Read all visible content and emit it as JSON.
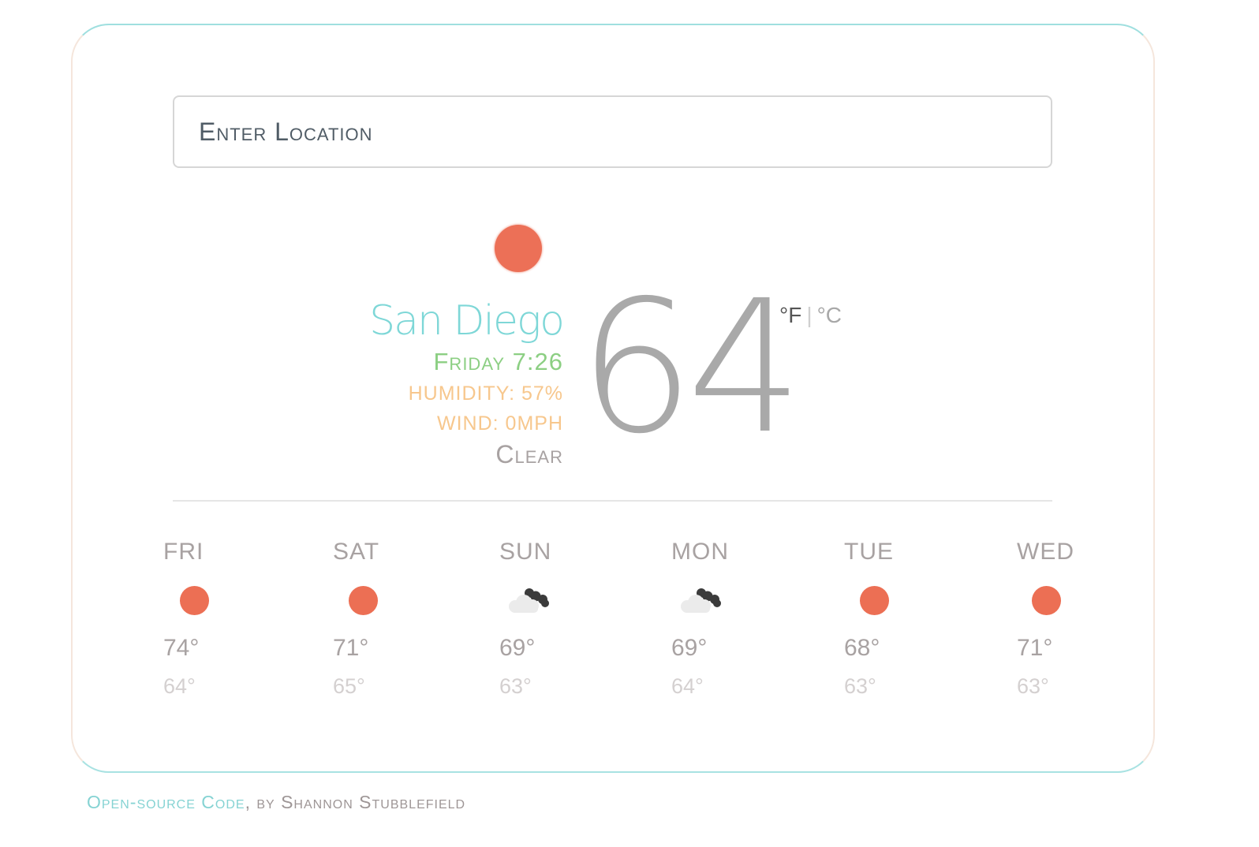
{
  "search": {
    "placeholder": "Enter Location"
  },
  "current": {
    "icon": "sun-icon",
    "city": "San Diego",
    "day_time": "Friday 7:26",
    "humidity": "HUMIDITY: 57%",
    "wind": "WIND: 0MPH",
    "condition": "Clear",
    "temperature": "64"
  },
  "units": {
    "fahrenheit": "°F",
    "separator": "|",
    "celsius": "°C",
    "selected": "fahrenheit"
  },
  "forecast": [
    {
      "day": "FRI",
      "icon": "sun-icon",
      "high": "74°",
      "low": "64°"
    },
    {
      "day": "SAT",
      "icon": "sun-icon",
      "high": "71°",
      "low": "65°"
    },
    {
      "day": "SUN",
      "icon": "partly-cloudy-night-icon",
      "high": "69°",
      "low": "63°"
    },
    {
      "day": "MON",
      "icon": "partly-cloudy-night-icon",
      "high": "69°",
      "low": "64°"
    },
    {
      "day": "TUE",
      "icon": "sun-icon",
      "high": "68°",
      "low": "63°"
    },
    {
      "day": "WED",
      "icon": "sun-icon",
      "high": "71°",
      "low": "63°"
    }
  ],
  "footer": {
    "link_text": "Open-source Code",
    "by_text": ", by Shannon Stubblefield"
  },
  "colors": {
    "accent_teal": "#7ed7d7",
    "sun_orange": "#ec7057",
    "green": "#8ccf83",
    "peach": "#f7c78d",
    "gray_text": "#a8a2a2"
  }
}
